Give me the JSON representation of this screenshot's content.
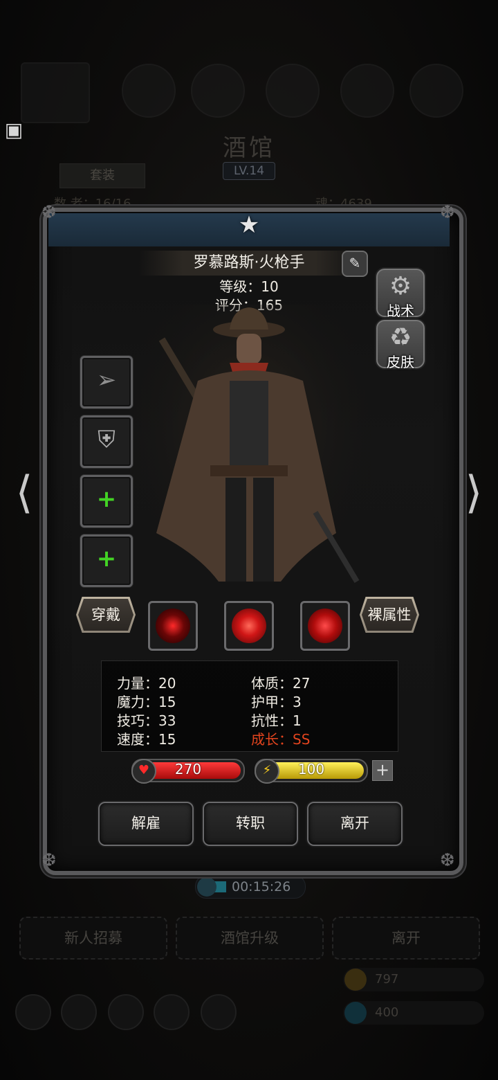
{
  "background": {
    "title": "酒馆",
    "level": "LV.14",
    "tab_suit": "套装",
    "stat_left": "数 老：16/16",
    "stat_right": "魂：4639",
    "timer": "00:15:26",
    "buttons": [
      "新人招募",
      "酒馆升级",
      "离开"
    ],
    "resources": [
      "797",
      "400"
    ]
  },
  "hero": {
    "name": "罗慕路斯·火枪手",
    "level_text": "等级：10",
    "score_text": "评分：165"
  },
  "side_buttons": {
    "tactics": "战术",
    "skin": "皮肤"
  },
  "equip_buttons": {
    "wear": "穿戴",
    "bare_attr": "裸属性"
  },
  "stats": {
    "strength": "力量：20",
    "constitution": "体质：27",
    "magic": "魔力：15",
    "armor": "护甲：3",
    "skill": "技巧：33",
    "resist": "抗性：1",
    "speed": "速度：15",
    "growth": "成长：SS"
  },
  "bars": {
    "hp": "270",
    "energy": "100"
  },
  "actions": {
    "dismiss": "解雇",
    "transfer": "转职",
    "leave": "离开"
  },
  "colors": {
    "hp": "#d21a1a",
    "energy": "#e0c20e",
    "growth": "#e2441e",
    "plus": "#43d325"
  }
}
